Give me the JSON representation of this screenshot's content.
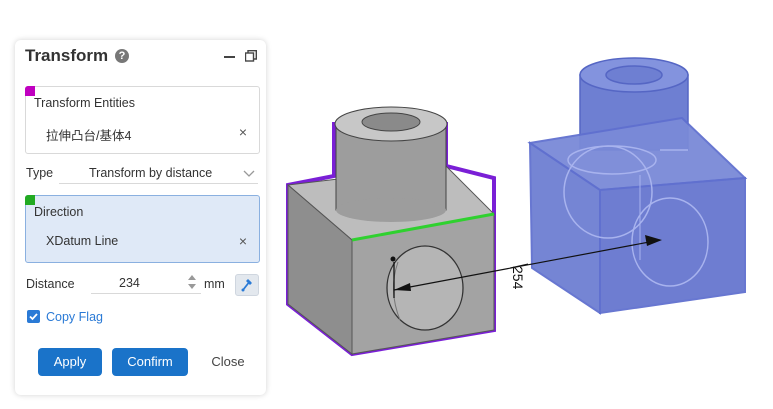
{
  "panel": {
    "title": "Transform",
    "help_icon": "question-circle-icon",
    "minimize_icon": "minimize-icon",
    "popout_icon": "popout-window-icon",
    "entities": {
      "label": "Transform Entities",
      "item": "拉伸凸台/基体4",
      "remove": "×",
      "marker_color": "#c000c0"
    },
    "type": {
      "label": "Type",
      "value": "Transform by distance"
    },
    "direction": {
      "label": "Direction",
      "item": "XDatum Line",
      "remove": "×",
      "marker_color": "#22aa22"
    },
    "distance": {
      "label": "Distance",
      "value": "234",
      "unit": "mm",
      "pick_icon": "pick-direction-icon"
    },
    "copy_flag": {
      "label": "Copy Flag",
      "checked": true
    },
    "buttons": {
      "apply": "Apply",
      "confirm": "Confirm",
      "close": "Close"
    }
  },
  "viewport": {
    "dimension_label": "254",
    "source_outline_color": "#7a1fd6",
    "edge_highlight_color": "#2fd12f",
    "preview_color": "#6e7fd2"
  }
}
